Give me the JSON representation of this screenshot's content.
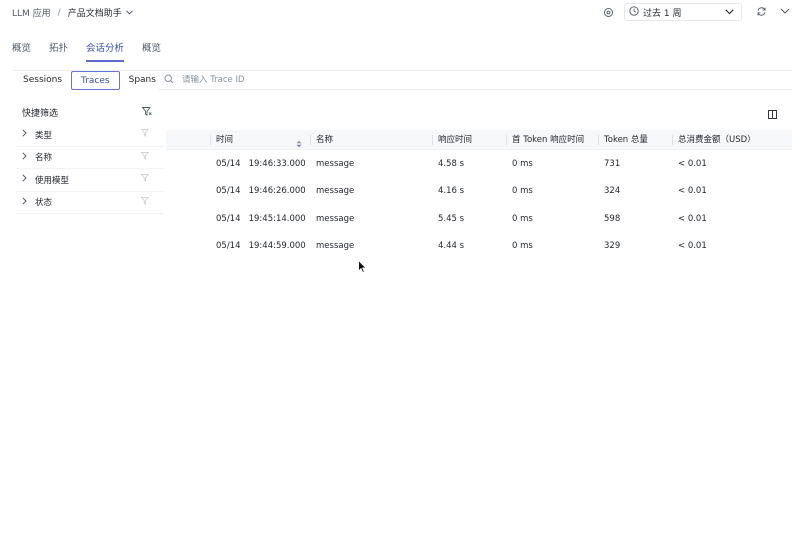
{
  "breadcrumb": {
    "app": "LLM 应用",
    "separator": "/",
    "current": "产品文档助手"
  },
  "time_range": {
    "label": "过去 1 周"
  },
  "tabs": [
    {
      "label": "概览",
      "active": false
    },
    {
      "label": "拓扑",
      "active": false
    },
    {
      "label": "会话分析",
      "active": true
    },
    {
      "label": "概览",
      "active": false
    }
  ],
  "subtabs": [
    {
      "label": "Sessions",
      "active": false
    },
    {
      "label": "Traces",
      "active": true
    },
    {
      "label": "Spans",
      "active": false
    }
  ],
  "search": {
    "placeholder": "请输入 Trace ID"
  },
  "quick_filter": {
    "title": "快捷筛选",
    "items": [
      {
        "label": "类型"
      },
      {
        "label": "名称"
      },
      {
        "label": "使用模型"
      },
      {
        "label": "状态"
      }
    ]
  },
  "table": {
    "columns": [
      "时间",
      "名称",
      "响应时间",
      "首 Token 响应时间",
      "Token 总量",
      "总消费金额（USD）"
    ],
    "rows": [
      {
        "date": "05/14",
        "time": "19:46:33.000",
        "name": "message",
        "latency": "4.58 s",
        "first_token": "0 ms",
        "tokens": "731",
        "cost": "< 0.01"
      },
      {
        "date": "05/14",
        "time": "19:46:26.000",
        "name": "message",
        "latency": "4.16 s",
        "first_token": "0 ms",
        "tokens": "324",
        "cost": "< 0.01"
      },
      {
        "date": "05/14",
        "time": "19:45:14.000",
        "name": "message",
        "latency": "5.45 s",
        "first_token": "0 ms",
        "tokens": "598",
        "cost": "< 0.01"
      },
      {
        "date": "05/14",
        "time": "19:44:59.000",
        "name": "message",
        "latency": "4.44 s",
        "first_token": "0 ms",
        "tokens": "329",
        "cost": "< 0.01"
      }
    ]
  },
  "colors": {
    "accent": "#5b6bc9",
    "text": "#1f2329",
    "muted": "#86909c",
    "header_bg": "#f7f8fa"
  },
  "icons": [
    "chevron-down-icon",
    "gear-icon",
    "clock-icon",
    "refresh-icon",
    "search-icon",
    "filter-icon",
    "chevron-right-icon",
    "columns-icon",
    "sort-icon",
    "cursor-icon"
  ]
}
